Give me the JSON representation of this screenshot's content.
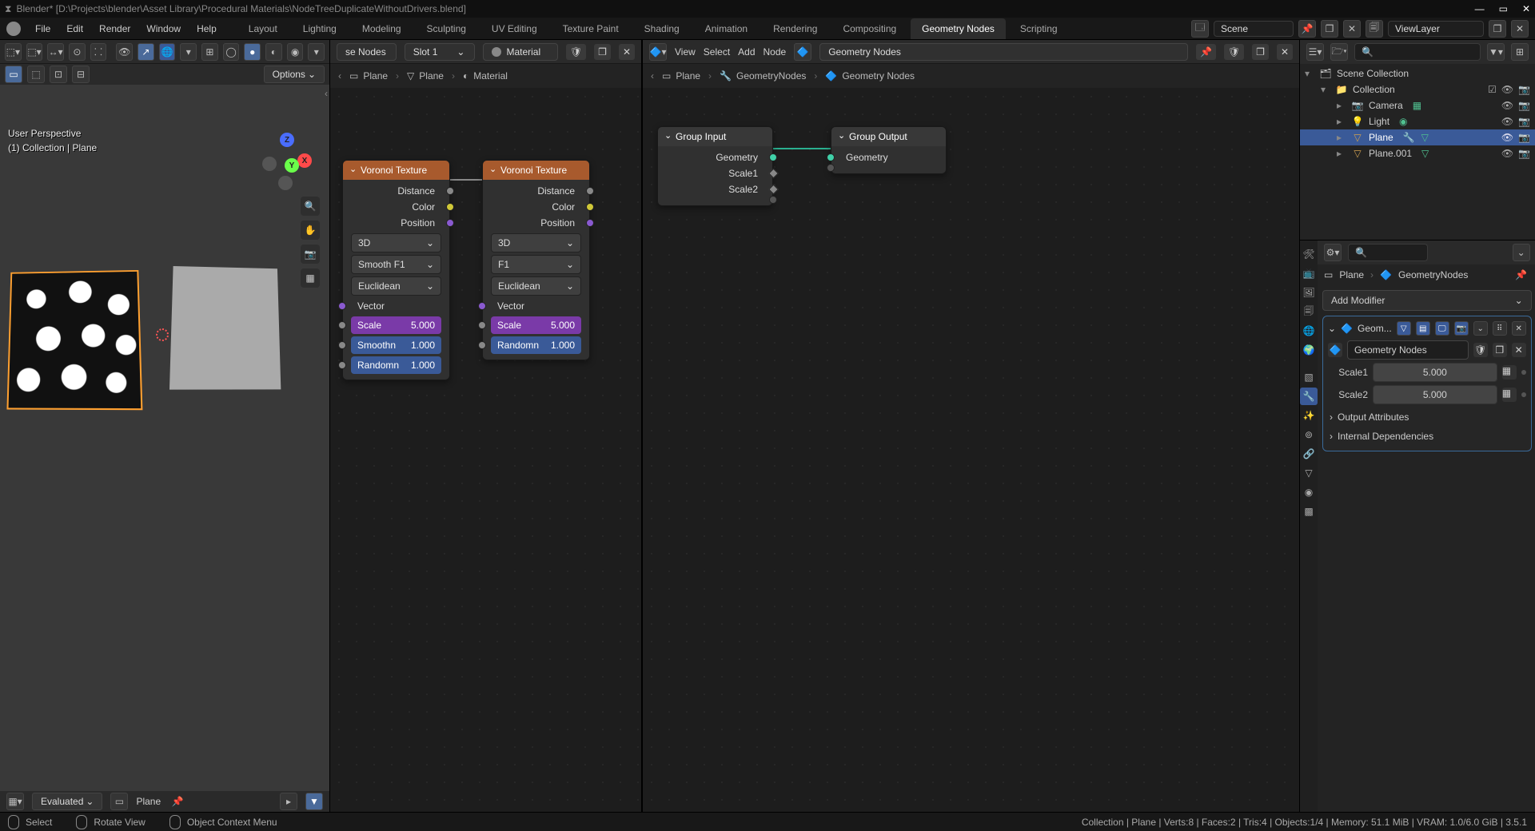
{
  "titlebar": {
    "text": "Blender* [D:\\Projects\\blender\\Asset Library\\Procedural Materials\\NodeTreeDuplicateWithoutDrivers.blend]",
    "logo": "Blender"
  },
  "menubar": {
    "items": [
      "File",
      "Edit",
      "Render",
      "Window",
      "Help"
    ],
    "tabs": [
      "Layout",
      "Lighting",
      "Modeling",
      "Sculpting",
      "UV Editing",
      "Texture Paint",
      "Shading",
      "Animation",
      "Rendering",
      "Compositing",
      "Geometry Nodes",
      "Scripting"
    ],
    "active_tab": "Geometry Nodes",
    "scene_label": "Scene",
    "viewlayer_label": "ViewLayer"
  },
  "viewport": {
    "options": "Options",
    "info_line1": "User Perspective",
    "info_line2": "(1) Collection | Plane",
    "footer_mode": "Evaluated",
    "footer_obj": "Plane",
    "axes": {
      "x": "X",
      "y": "Y",
      "z": "Z"
    }
  },
  "shader_editor": {
    "header": {
      "use_nodes": "se Nodes",
      "slot": "Slot 1",
      "material": "Material"
    },
    "crumbs": [
      "Plane",
      "Plane",
      "Material"
    ],
    "nodes": {
      "voronoi1": {
        "title": "Voronoi Texture",
        "outputs": [
          "Distance",
          "Color",
          "Position"
        ],
        "dim": "3D",
        "feature": "Smooth F1",
        "metric": "Euclidean",
        "vector_label": "Vector",
        "scale": {
          "label": "Scale",
          "value": "5.000"
        },
        "smooth": {
          "label": "Smoothn",
          "value": "1.000"
        },
        "random": {
          "label": "Randomn",
          "value": "1.000"
        }
      },
      "voronoi2": {
        "title": "Voronoi Texture",
        "outputs": [
          "Distance",
          "Color",
          "Position"
        ],
        "dim": "3D",
        "feature": "F1",
        "metric": "Euclidean",
        "vector_label": "Vector",
        "scale": {
          "label": "Scale",
          "value": "5.000"
        },
        "random": {
          "label": "Randomn",
          "value": "1.000"
        }
      }
    }
  },
  "geo_editor": {
    "header": {
      "menus": [
        "View",
        "Select",
        "Add",
        "Node"
      ],
      "tree": "Geometry Nodes"
    },
    "crumbs": [
      "Plane",
      "GeometryNodes",
      "Geometry Nodes"
    ],
    "nodes": {
      "group_input": {
        "title": "Group Input",
        "outputs": [
          "Geometry",
          "Scale1",
          "Scale2"
        ]
      },
      "group_output": {
        "title": "Group Output",
        "inputs": [
          "Geometry"
        ]
      }
    }
  },
  "outliner": {
    "title": "Scene Collection",
    "collection": "Collection",
    "items": [
      {
        "name": "Camera",
        "icon": "📷",
        "color": "#d0a050"
      },
      {
        "name": "Light",
        "icon": "💡",
        "color": "#d0a050"
      },
      {
        "name": "Plane",
        "icon": "▽",
        "color": "#d0a050",
        "selected": true
      },
      {
        "name": "Plane.001",
        "icon": "▽",
        "color": "#d0a050"
      }
    ]
  },
  "properties": {
    "crumb_obj": "Plane",
    "crumb_tree": "GeometryNodes",
    "add_modifier": "Add Modifier",
    "mod_name": "Geom...",
    "ng_label": "Geometry Nodes",
    "inputs": [
      {
        "label": "Scale1",
        "value": "5.000"
      },
      {
        "label": "Scale2",
        "value": "5.000"
      }
    ],
    "section_output": "Output Attributes",
    "section_internal": "Internal Dependencies"
  },
  "statusbar": {
    "hints": [
      "Select",
      "Rotate View",
      "Object Context Menu"
    ],
    "stats": "Collection | Plane | Verts:8 | Faces:2 | Tris:4 | Objects:1/4 | Memory: 51.1 MiB | VRAM: 1.0/6.0 GiB | 3.5.1"
  }
}
